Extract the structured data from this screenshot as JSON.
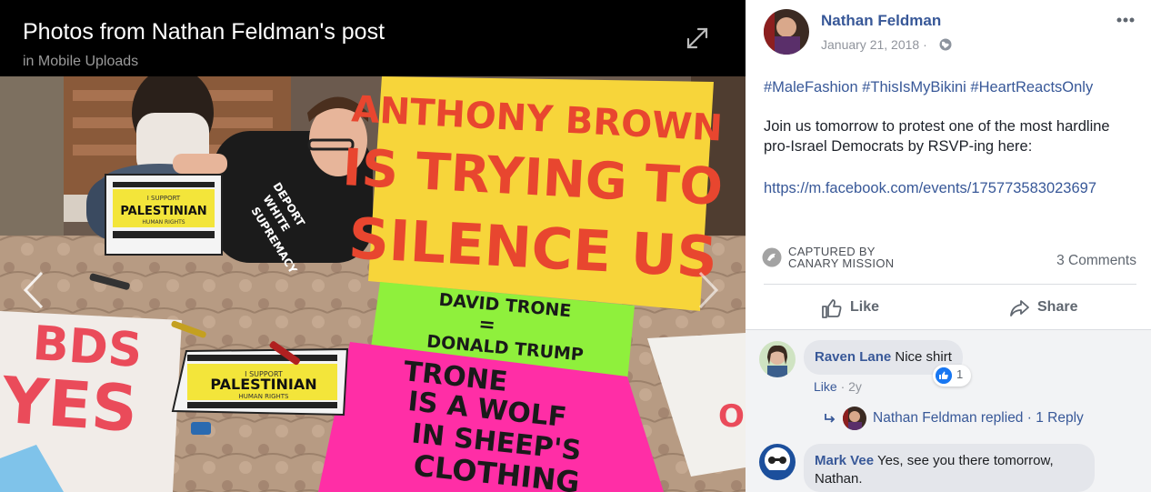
{
  "viewer": {
    "title": "Photos from Nathan Feldman's post",
    "subtitle": "in Mobile Uploads"
  },
  "photo": {
    "signs": {
      "big": [
        "ANTHONY BROWN",
        "IS TRYING TO",
        "SILENCE US"
      ],
      "green": [
        "DAVID TRONE",
        "=",
        "DONALD TRUMP"
      ],
      "pink": [
        "TRONE",
        "IS A WOLF",
        "IN SHEEP'S",
        "CLOTHING"
      ],
      "red": [
        "BDS",
        "YES"
      ],
      "placard_top": "I SUPPORT",
      "placard_main": "PALESTINIAN",
      "placard_bottom": "HUMAN RIGHTS",
      "shirt": [
        "DEPORT",
        "WHITE",
        "SUPREMACY"
      ]
    }
  },
  "post": {
    "author": "Nathan Feldman",
    "date": "January 21, 2018 ·",
    "hashtags": "#MaleFashion #ThisIsMyBikini #HeartReactsOnly",
    "body": "Join us tomorrow to protest one of the most hardline pro-Israel Democrats by RSVP-ing here:",
    "link": "https://m.facebook.com/events/175773583023697",
    "captured_line1": "CAPTURED BY",
    "captured_line2": "CANARY MISSION",
    "comment_count": "3 Comments",
    "actions": {
      "like": "Like",
      "share": "Share"
    }
  },
  "comments": [
    {
      "name": "Raven Lane",
      "text": "Nice shirt",
      "like": "Like",
      "age": " · 2y",
      "reactions": "1",
      "reply_text": "Nathan Feldman replied · 1 Reply"
    },
    {
      "name": "Mark Vee",
      "text": "Yes, see you there tomorrow, Nathan."
    }
  ],
  "colors": {
    "link_blue": "#385898",
    "reaction_blue": "#1877f2",
    "sign_yellow": "#f7d53a",
    "sign_green": "#8ff03c",
    "sign_pink": "#ff2ea6"
  },
  "icons": [
    "expand-icon",
    "chevron-left-icon",
    "chevron-right-icon",
    "globe-icon",
    "more-icon",
    "like-icon",
    "share-icon",
    "reply-arrow-icon",
    "canary-mission-icon"
  ]
}
